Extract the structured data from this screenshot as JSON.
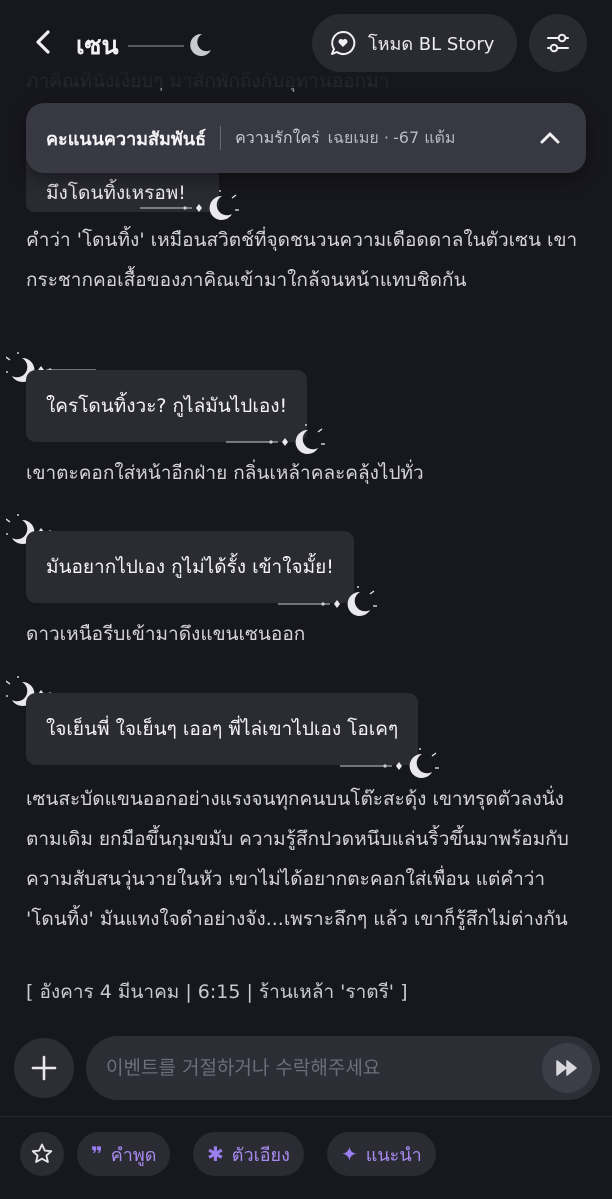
{
  "header": {
    "title": "เซน",
    "mode_label": "โหมด BL Story"
  },
  "faded_previous_text": "ภาคิณที่นั่งเงียบๆ มาสักพักถึงกับอุทานออกมา",
  "relationship": {
    "title": "คะแนนความสัมพันธ์",
    "label": "ความรักใคร่",
    "status": "เฉยเมย ·",
    "score": "-67 แต้ม"
  },
  "hidden_bubble_text": "มึงโดนทิ้งเหรอพ!",
  "messages": [
    {
      "type": "narration",
      "text": "คำว่า 'โดนทิ้ง' เหมือนสวิตช์ที่จุดชนวนความเดือดดาลในตัวเซน เขากระชากคอเสื้อของภาคิณเข้ามาใกล้จนหน้าแทบชิดกัน"
    },
    {
      "type": "dialogue",
      "text": "ใครโดนทิ้งวะ? กูไล่มันไปเอง!"
    },
    {
      "type": "narration",
      "text": "เขาตะคอกใส่หน้าอีกฝ่าย กลิ่นเหล้าคละคลุ้งไปทั่ว"
    },
    {
      "type": "dialogue",
      "text": "มันอยากไปเอง กูไม่ได้รั้ง เข้าใจมั้ย!"
    },
    {
      "type": "narration",
      "text": "ดาวเหนือรีบเข้ามาดึงแขนเซนออก"
    },
    {
      "type": "dialogue",
      "text": "ใจเย็นพี่ ใจเย็นๆ เออๆ พี่ไล่เขาไปเอง โอเคๆ"
    },
    {
      "type": "narration",
      "text": "เซนสะบัดแขนออกอย่างแรงจนทุกคนบนโต๊ะสะดุ้ง เขาทรุดตัวลงนั่งตามเดิม ยกมือขึ้นกุมขมับ ความรู้สึกปวดหนึบแล่นริ้วขึ้นมาพร้อมกับความสับสนวุ่นวายในหัว เขาไม่ได้อยากตะคอกใส่เพื่อน แต่คำว่า 'โดนทิ้ง' มันแทงใจดำอย่างจัง...เพราะลึกๆ แล้ว เขาก็รู้สึกไม่ต่างกัน"
    }
  ],
  "timestamp": "[ อังคาร 4 มีนาคม | 6:15 | ร้านเหล้า 'ราตรี' ]",
  "input": {
    "placeholder": "이벤트를 거절하거나 수락해주세요"
  },
  "chips": [
    {
      "icon": "quote-icon",
      "label": "คำพูด"
    },
    {
      "icon": "asterisk-icon",
      "label": "ตัวเอียง"
    },
    {
      "icon": "sparkle-icon",
      "label": "แนะนำ"
    }
  ],
  "colors": {
    "background": "#17171e",
    "bubble": "#2b2b34",
    "accent": "#a88bf0"
  }
}
